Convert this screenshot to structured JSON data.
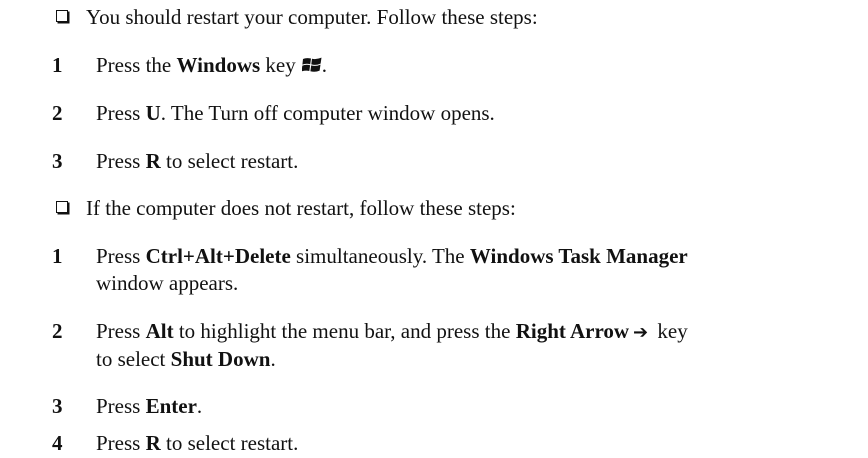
{
  "section1": {
    "intro": "You should restart your computer. Follow these steps:",
    "steps": [
      {
        "num": "1",
        "pre": "Press the ",
        "b1": "Windows",
        "post": " key",
        "end": "."
      },
      {
        "num": "2",
        "pre": "Press ",
        "b1": "U",
        "post": ". The Turn off computer window opens."
      },
      {
        "num": "3",
        "pre": "Press ",
        "b1": "R",
        "post": " to select restart."
      }
    ]
  },
  "section2": {
    "intro": "If the computer does not restart, follow these steps:",
    "steps": [
      {
        "num": "1",
        "pre": "Press ",
        "b1": "Ctrl+Alt+Delete",
        "mid": " simultaneously. The ",
        "b2": "Windows Task Manager",
        "line2": "window appears."
      },
      {
        "num": "2",
        "pre": "Press ",
        "b1": "Alt",
        "mid": " to highlight the menu bar, and press the ",
        "b2": "Right Arrow",
        "arrow": "➔",
        "post": " key",
        "line2pre": "to select ",
        "b3": "Shut Down",
        "line2end": "."
      },
      {
        "num": "3",
        "pre": "Press ",
        "b1": "Enter",
        "post": "."
      },
      {
        "num": "4",
        "pre": "Press ",
        "b1": "R",
        "post": " to select restart."
      }
    ]
  },
  "icons": {
    "checkbox": "empty-square-bullet",
    "windows_key": "windows-logo-icon",
    "arrow": "right-arrow-icon"
  }
}
